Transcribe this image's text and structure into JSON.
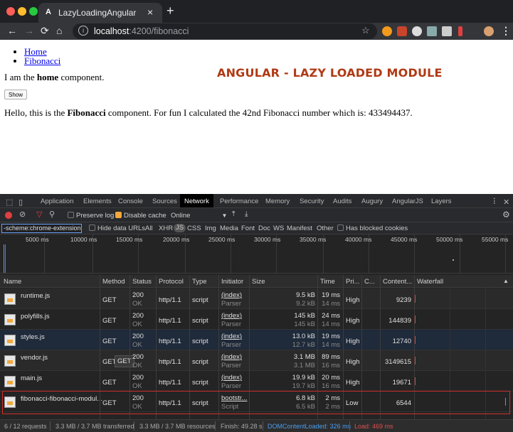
{
  "browser": {
    "tab_title": "LazyLoadingAngular",
    "tab_icon_label": "A",
    "url_host": "localhost",
    "url_path": ":4200/fibonacci",
    "close_glyph": "×",
    "newtab_glyph": "+"
  },
  "page": {
    "nav": [
      "Home",
      "Fibonacci"
    ],
    "home_text_pre": "I am the ",
    "home_text_bold": "home",
    "home_text_post": " component.",
    "show_button": "Show",
    "fib_text_pre": "Hello, this is the ",
    "fib_text_bold": "Fibonacci",
    "fib_text_post": " component. For fun I calculated the 42nd Fibonacci number which is: 433494437.",
    "banner": "ANGULAR - LAZY LOADED MODULE"
  },
  "devtools": {
    "tabs": [
      "Application",
      "Elements",
      "Console",
      "Sources",
      "Network",
      "Performance",
      "Memory",
      "Security",
      "Audits",
      "Augury",
      "AngularJS",
      "Layers"
    ],
    "active_tab": "Network",
    "toolbar": {
      "preserve_log": "Preserve log",
      "disable_cache": "Disable cache",
      "throttle": "Online"
    },
    "filter": {
      "value": "-scheme:chrome-extension",
      "hide_data_urls": "Hide data URLs",
      "types": [
        "All",
        "XHR",
        "JS",
        "CSS",
        "Img",
        "Media",
        "Font",
        "Doc",
        "WS",
        "Manifest",
        "Other"
      ],
      "selected_type": "JS",
      "blocked_cookies": "Has blocked cookies"
    },
    "overview_labels": [
      "5000 ms",
      "10000 ms",
      "15000 ms",
      "20000 ms",
      "25000 ms",
      "30000 ms",
      "35000 ms",
      "40000 ms",
      "45000 ms",
      "50000 ms",
      "55000 ms"
    ],
    "columns": [
      "Name",
      "Method",
      "Status",
      "Protocol",
      "Type",
      "Initiator",
      "Size",
      "Time",
      "Pri...",
      "C...",
      "Content...",
      "Waterfall"
    ],
    "rows": [
      {
        "name": "runtime.js",
        "method": "GET",
        "status": "200",
        "status_text": "OK",
        "protocol": "http/1.1",
        "type": "script",
        "initiator": "(index)",
        "initiator_sub": "Parser",
        "size": "9.5 kB",
        "size_sub": "9.2 kB",
        "time": "19 ms",
        "time_sub": "14 ms",
        "priority": "High",
        "content": "9239"
      },
      {
        "name": "polyfills.js",
        "method": "GET",
        "status": "200",
        "status_text": "OK",
        "protocol": "http/1.1",
        "type": "script",
        "initiator": "(index)",
        "initiator_sub": "Parser",
        "size": "145 kB",
        "size_sub": "145 kB",
        "time": "24 ms",
        "time_sub": "14 ms",
        "priority": "High",
        "content": "144839"
      },
      {
        "name": "styles.js",
        "method": "GET",
        "status": "200",
        "status_text": "OK",
        "protocol": "http/1.1",
        "type": "script",
        "initiator": "(index)",
        "initiator_sub": "Parser",
        "size": "13.0 kB",
        "size_sub": "12.7 kB",
        "time": "19 ms",
        "time_sub": "14 ms",
        "priority": "High",
        "content": "12740"
      },
      {
        "name": "vendor.js",
        "method": "GET",
        "method_tooltip": "GET",
        "status": "200",
        "status_text": "OK",
        "protocol": "http/1.1",
        "type": "script",
        "initiator": "(index)",
        "initiator_sub": "Parser",
        "size": "3.1 MB",
        "size_sub": "3.1 MB",
        "time": "89 ms",
        "time_sub": "16 ms",
        "priority": "High",
        "content": "3149615"
      },
      {
        "name": "main.js",
        "method": "GET",
        "status": "200",
        "status_text": "OK",
        "protocol": "http/1.1",
        "type": "script",
        "initiator": "(index)",
        "initiator_sub": "Parser",
        "size": "19.9 kB",
        "size_sub": "19.7 kB",
        "time": "20 ms",
        "time_sub": "16 ms",
        "priority": "High",
        "content": "19671"
      },
      {
        "name": "fibonacci-fibonacci-modul...",
        "method": "GET",
        "status": "200",
        "status_text": "OK",
        "protocol": "http/1.1",
        "type": "script",
        "initiator": "bootstr...",
        "initiator_sub": "Script",
        "size": "6.8 kB",
        "size_sub": "6.5 kB",
        "time": "2 ms",
        "time_sub": "2 ms",
        "priority": "Low",
        "content": "6544"
      }
    ],
    "status_bar": {
      "requests": "6 / 12 requests",
      "transferred": "3.3 MB / 3.7 MB transferred",
      "resources": "3.3 MB / 3.7 MB resources",
      "finish": "Finish: 49.28 s",
      "dom": "DOMContentLoaded: 326 ms",
      "load": "Load: 469 ms"
    },
    "colors": {
      "highlight": "#e03030",
      "dom": "#4a9ef0",
      "load": "#e05050"
    }
  }
}
